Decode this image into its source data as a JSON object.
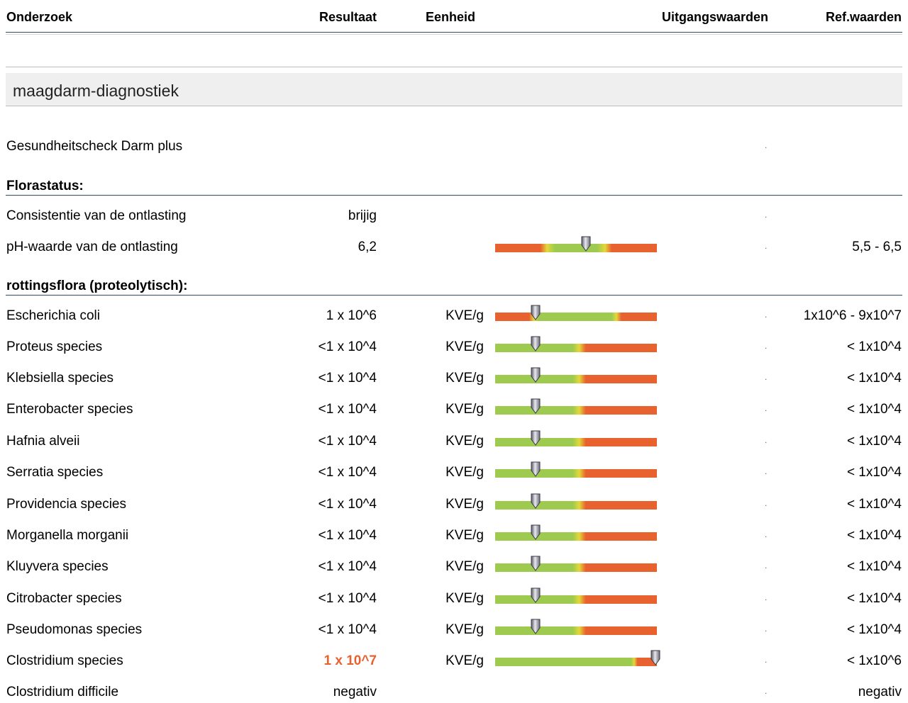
{
  "header": {
    "col_test": "Onderzoek",
    "col_result": "Resultaat",
    "col_unit": "Eenheid",
    "col_baseline": "Uitgangswaarden",
    "col_ref": "Ref.waarden"
  },
  "section": {
    "title": "maagdarm-diagnostiek"
  },
  "panel": {
    "name": "Gesundheitscheck Darm plus",
    "dot": "."
  },
  "groups": {
    "flora": "Florastatus:",
    "proteo": "rottingsflora (proteolytisch):"
  },
  "rows": [
    {
      "name": "Consistentie van de ontlasting",
      "result": "brijig",
      "unit": "",
      "dot": ".",
      "ref": "",
      "bar": null
    },
    {
      "name": "pH-waarde van de ontlasting",
      "result": "6,2",
      "unit": "",
      "dot": ".",
      "ref": "5,5 - 6,5",
      "bar": {
        "type": "range",
        "marker": 0.56
      }
    },
    {
      "name": "Escherichia coli",
      "result": "1 x 10^6",
      "unit": "KVE/g",
      "dot": ".",
      "ref": "1x10^6 - 9x10^7",
      "bar": {
        "type": "range_log",
        "marker": 0.25
      }
    },
    {
      "name": "Proteus species",
      "result": "<1 x 10^4",
      "unit": "KVE/g",
      "dot": ".",
      "ref": "< 1x10^4",
      "bar": {
        "type": "upper",
        "marker": 0.25
      }
    },
    {
      "name": "Klebsiella species",
      "result": "<1 x 10^4",
      "unit": "KVE/g",
      "dot": ".",
      "ref": "< 1x10^4",
      "bar": {
        "type": "upper",
        "marker": 0.25
      }
    },
    {
      "name": "Enterobacter species",
      "result": "<1 x 10^4",
      "unit": "KVE/g",
      "dot": ".",
      "ref": "< 1x10^4",
      "bar": {
        "type": "upper",
        "marker": 0.25
      }
    },
    {
      "name": "Hafnia alveii",
      "result": "<1 x 10^4",
      "unit": "KVE/g",
      "dot": ".",
      "ref": "< 1x10^4",
      "bar": {
        "type": "upper",
        "marker": 0.25
      }
    },
    {
      "name": "Serratia species",
      "result": "<1 x 10^4",
      "unit": "KVE/g",
      "dot": ".",
      "ref": "< 1x10^4",
      "bar": {
        "type": "upper",
        "marker": 0.25
      }
    },
    {
      "name": "Providencia species",
      "result": "<1 x 10^4",
      "unit": "KVE/g",
      "dot": ".",
      "ref": "< 1x10^4",
      "bar": {
        "type": "upper",
        "marker": 0.25
      }
    },
    {
      "name": "Morganella morganii",
      "result": "<1 x 10^4",
      "unit": "KVE/g",
      "dot": ".",
      "ref": "< 1x10^4",
      "bar": {
        "type": "upper",
        "marker": 0.25
      }
    },
    {
      "name": "Kluyvera species",
      "result": "<1 x 10^4",
      "unit": "KVE/g",
      "dot": ".",
      "ref": "< 1x10^4",
      "bar": {
        "type": "upper",
        "marker": 0.25
      }
    },
    {
      "name": "Citrobacter species",
      "result": "<1 x 10^4",
      "unit": "KVE/g",
      "dot": ".",
      "ref": "< 1x10^4",
      "bar": {
        "type": "upper",
        "marker": 0.25
      }
    },
    {
      "name": "Pseudomonas species",
      "result": "<1 x 10^4",
      "unit": "KVE/g",
      "dot": ".",
      "ref": "< 1x10^4",
      "bar": {
        "type": "upper",
        "marker": 0.25
      }
    },
    {
      "name": "Clostridium species",
      "result": "1 x 10^7",
      "unit": "KVE/g",
      "dot": ".",
      "ref": "< 1x10^6",
      "flag": true,
      "bar": {
        "type": "upper_high",
        "marker": 0.99
      }
    },
    {
      "name": "Clostridium difficile",
      "result": "negativ",
      "unit": "",
      "dot": ".",
      "ref": "negativ",
      "bar": null
    }
  ],
  "colors": {
    "red": "#e8622f",
    "green": "#9dca4f",
    "yellow": "#e3d83a",
    "line": "#2f4a6a",
    "section_bg": "#efefef",
    "flag": "#e8622f"
  }
}
